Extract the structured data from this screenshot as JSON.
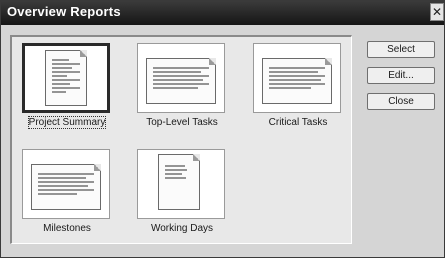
{
  "dialog": {
    "title": "Overview Reports",
    "close_glyph": "✕"
  },
  "reports": [
    {
      "label": "Project Summary",
      "selected": true
    },
    {
      "label": "Top-Level Tasks",
      "selected": false
    },
    {
      "label": "Critical Tasks",
      "selected": false
    },
    {
      "label": "Milestones",
      "selected": false
    },
    {
      "label": "Working Days",
      "selected": false
    }
  ],
  "buttons": {
    "select": "Select",
    "edit": "Edit...",
    "close": "Close"
  },
  "icons": {
    "close": "close-icon",
    "report_thumbnail": "report-document-icon"
  }
}
